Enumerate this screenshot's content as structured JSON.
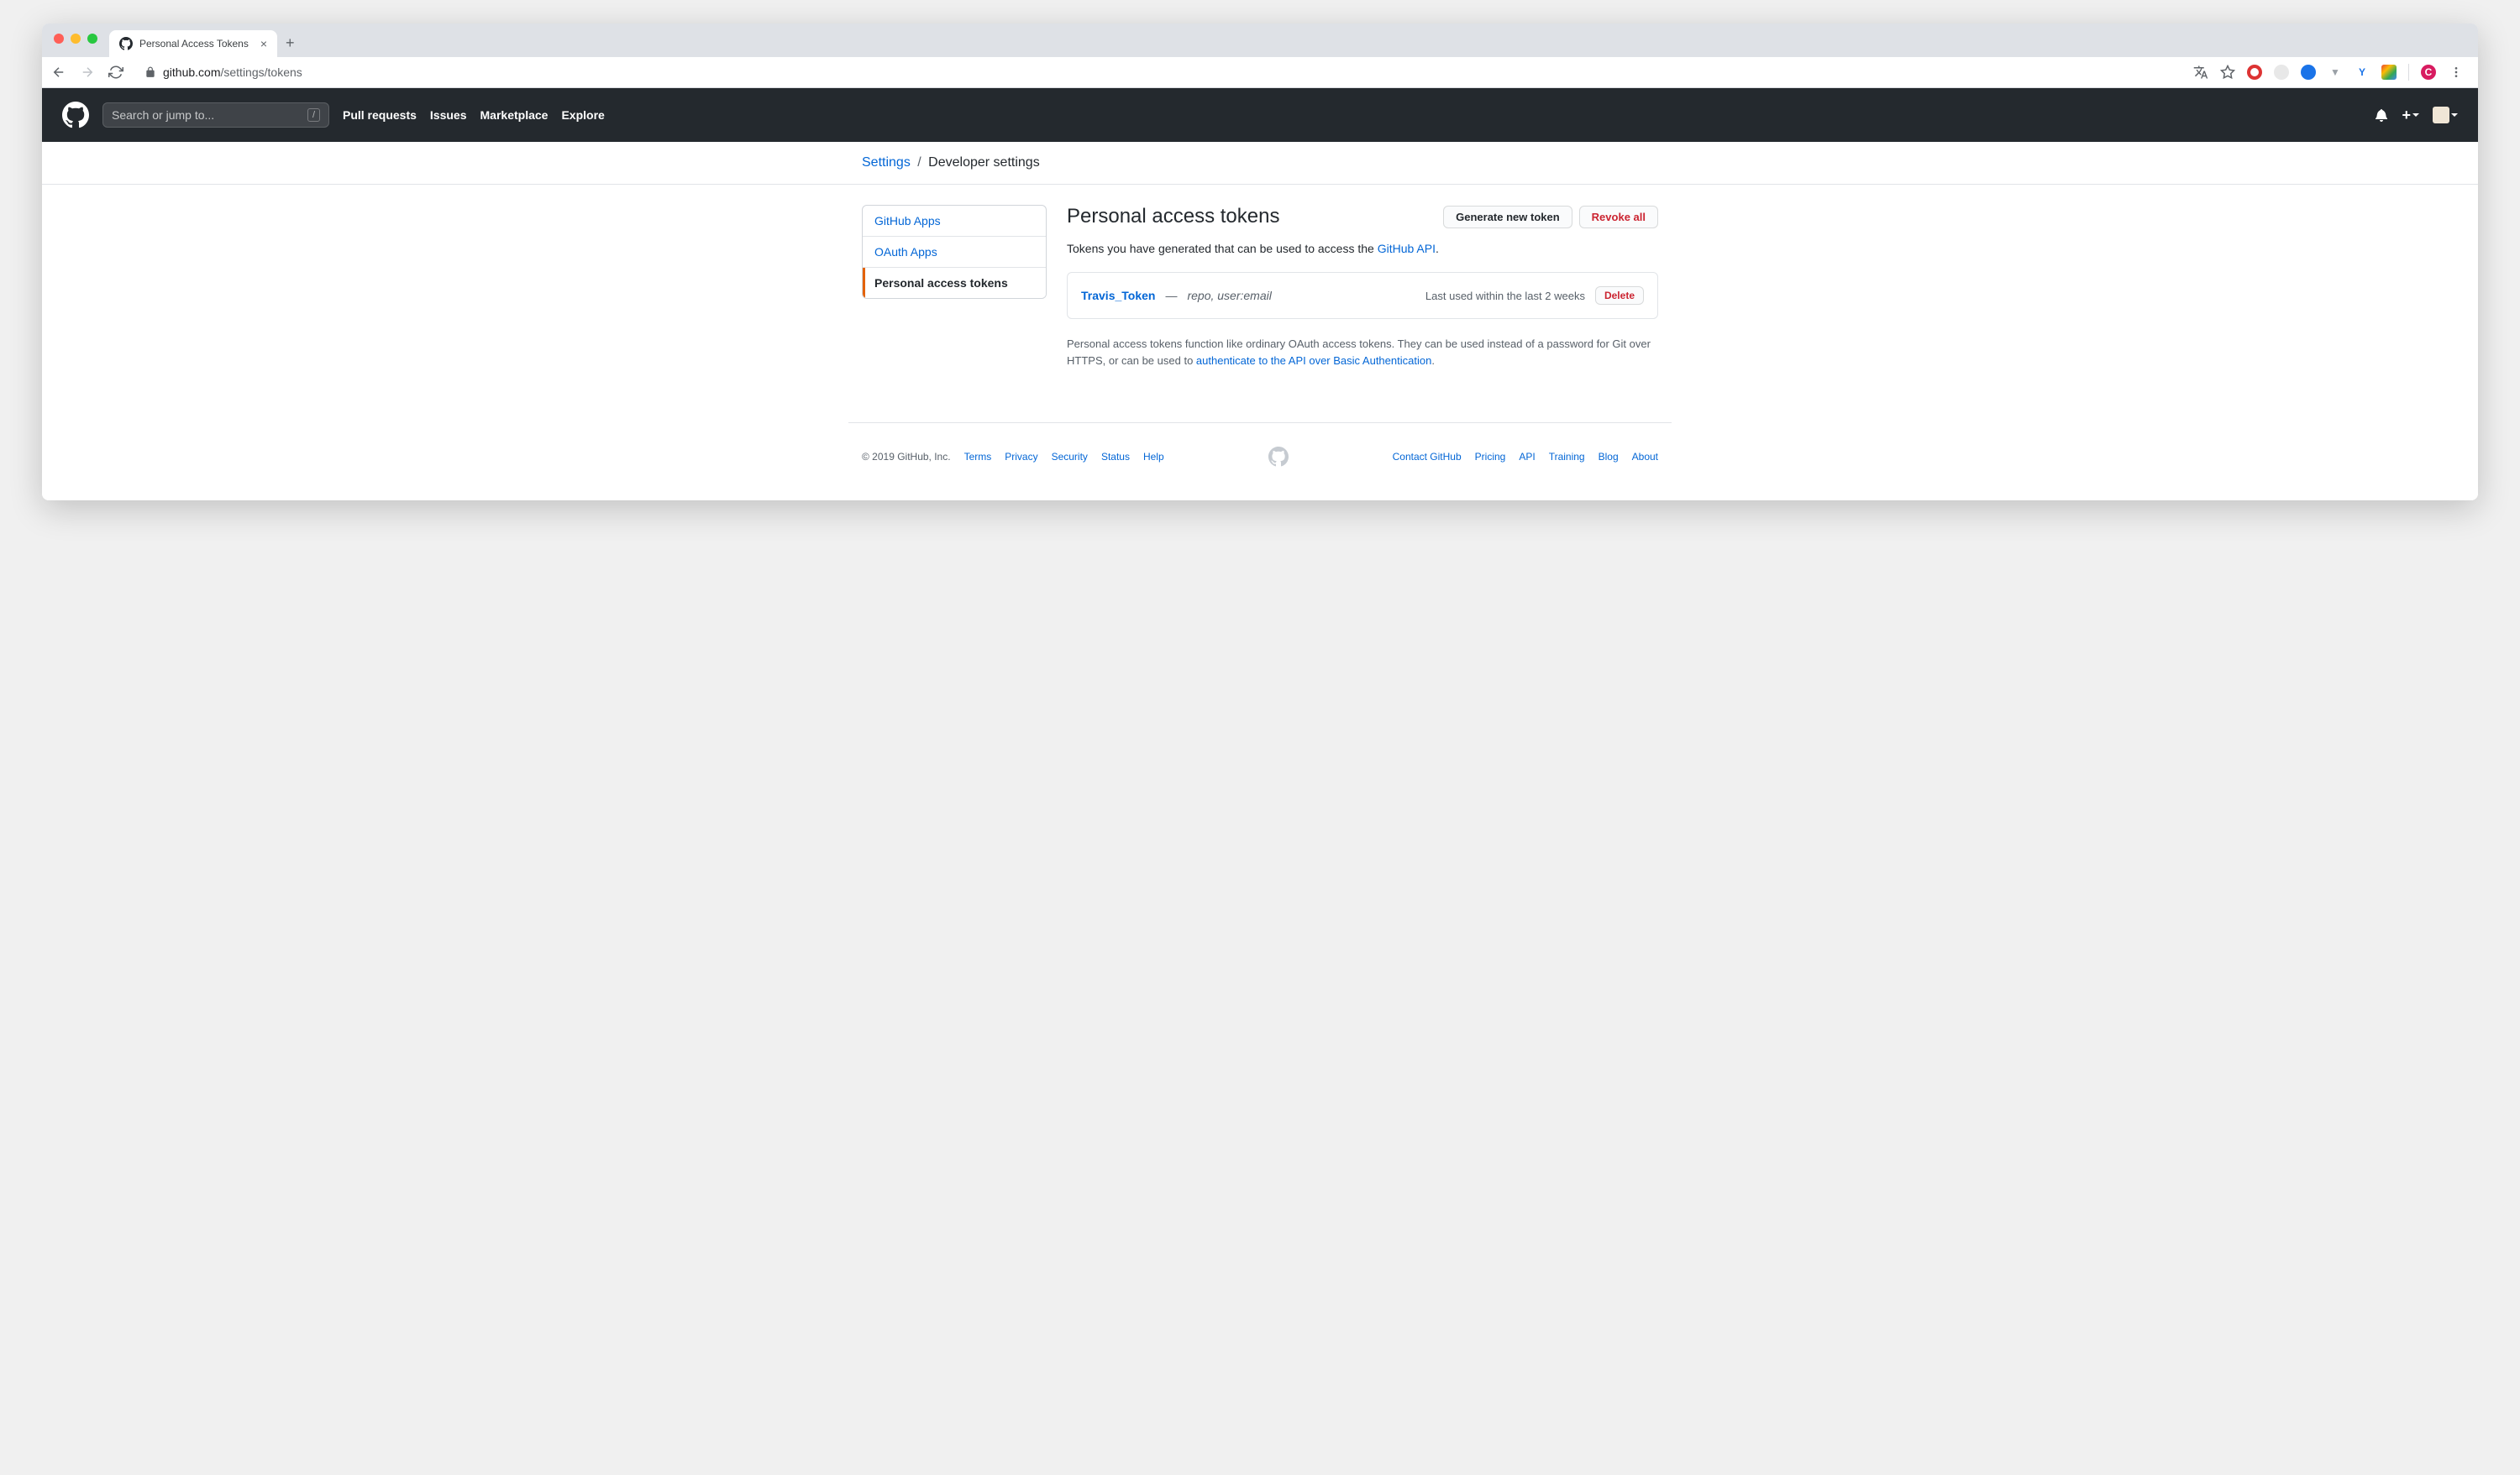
{
  "browser": {
    "tab_title": "Personal Access Tokens",
    "url_domain": "github.com",
    "url_path": "/settings/tokens"
  },
  "header": {
    "search_placeholder": "Search or jump to...",
    "slash": "/",
    "nav": {
      "pull_requests": "Pull requests",
      "issues": "Issues",
      "marketplace": "Marketplace",
      "explore": "Explore"
    }
  },
  "breadcrumb": {
    "settings": "Settings",
    "separator": "/",
    "current": "Developer settings"
  },
  "sidebar": {
    "github_apps": "GitHub Apps",
    "oauth_apps": "OAuth Apps",
    "pat": "Personal access tokens"
  },
  "page": {
    "title": "Personal access tokens",
    "generate_btn": "Generate new token",
    "revoke_btn": "Revoke all",
    "intro_prefix": "Tokens you have generated that can be used to access the ",
    "intro_link": "GitHub API",
    "intro_suffix": ".",
    "tokens": [
      {
        "name": "Travis_Token",
        "dash": "—",
        "scopes": "repo, user:email",
        "last_used": "Last used within the last 2 weeks",
        "delete": "Delete"
      }
    ],
    "explain_prefix": "Personal access tokens function like ordinary OAuth access tokens. They can be used instead of a password for Git over HTTPS, or can be used to ",
    "explain_link": "authenticate to the API over Basic Authentication",
    "explain_suffix": "."
  },
  "footer": {
    "copyright": "© 2019 GitHub, Inc.",
    "left": {
      "terms": "Terms",
      "privacy": "Privacy",
      "security": "Security",
      "status": "Status",
      "help": "Help"
    },
    "right": {
      "contact": "Contact GitHub",
      "pricing": "Pricing",
      "api": "API",
      "training": "Training",
      "blog": "Blog",
      "about": "About"
    }
  }
}
